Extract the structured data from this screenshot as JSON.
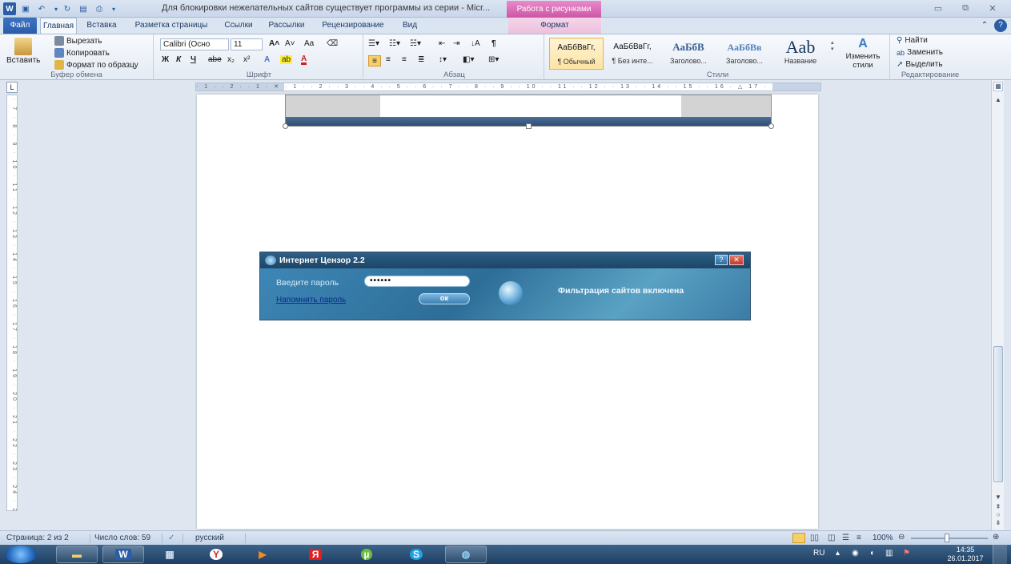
{
  "titlebar": {
    "doc_title": "Для блокировки нежелательных сайтов существует программы из серии - Micr...",
    "context_group": "Работа с рисунками",
    "minimize": "▭",
    "restore": "⧉",
    "close": "✕"
  },
  "tabs": {
    "file": "Файл",
    "home": "Главная",
    "insert": "Вставка",
    "layout": "Разметка страницы",
    "references": "Ссылки",
    "mailings": "Рассылки",
    "review": "Рецензирование",
    "view": "Вид",
    "format": "Формат"
  },
  "ribbon": {
    "clipboard": {
      "paste": "Вставить",
      "cut": "Вырезать",
      "copy": "Копировать",
      "format_painter": "Формат по образцу",
      "label": "Буфер обмена"
    },
    "font": {
      "font_name": "Calibri (Осно",
      "font_size": "11",
      "bold": "Ж",
      "italic": "К",
      "underline": "Ч",
      "strike": "abe",
      "subscript": "x₂",
      "superscript": "x²",
      "grow": "A˄",
      "shrink": "A˅",
      "case": "Aa",
      "label": "Шрифт"
    },
    "paragraph": {
      "label": "Абзац",
      "pilcrow": "¶"
    },
    "styles": {
      "label": "Стили",
      "items": [
        {
          "sample": "АаБбВвГг,",
          "name": "¶ Обычный"
        },
        {
          "sample": "АаБбВвГг,",
          "name": "¶ Без инте..."
        },
        {
          "sample": "АаБбВ",
          "name": "Заголово..."
        },
        {
          "sample": "АаБбВв",
          "name": "Заголово..."
        },
        {
          "sample": "Aab",
          "name": "Название"
        }
      ],
      "change_styles": "Изменить стили"
    },
    "editing": {
      "find": "Найти",
      "replace": "Заменить",
      "select": "Выделить",
      "label": "Редактирование"
    }
  },
  "ruler": {
    "marks": "· 1 · · 2 · · 1 · ✕ · 1 · · 2 · · 3 · · 4 · · 5 · · 6 · · 7 · · 8 · · 9 · · 10 · · 11 · · 12 · · 13 · · 14 · · 15 · · 16 · △ 17 ·",
    "vmarks": "· 7 · 8 · 9 · 10 · 11 · 12 · 13 · 14 · 15 · 16 · 17 · 18 · 19 · 20 · 21 · 22 · 23 · 24 · 25 · 26 ·",
    "corner": "L"
  },
  "dialog": {
    "title": "Интернет Цензор 2.2",
    "help": "?",
    "close": "✕",
    "password_label": "Введите пароль",
    "password_value": "••••••",
    "remind_link": "Напомнить пароль",
    "ok": "ок",
    "status": "Фильтрация сайтов включена"
  },
  "statusbar": {
    "page": "Страница: 2 из 2",
    "words": "Число слов: 59",
    "language": "русский",
    "zoom": "100%"
  },
  "taskbar": {
    "lang": "RU",
    "time": "14:35",
    "date": "26.01.2017"
  },
  "colors": {
    "file_tab": "#2a5ca8",
    "context_tab": "#cc56a6",
    "taskbar": "#1f3f63"
  }
}
